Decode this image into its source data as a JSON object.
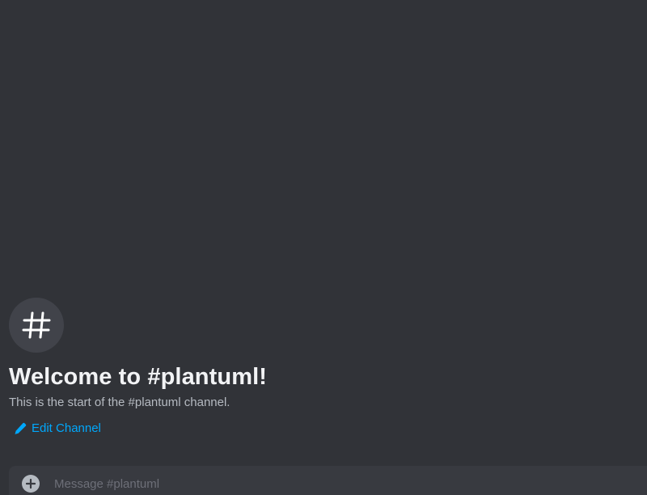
{
  "channel": {
    "name": "plantuml",
    "icon": "hash-icon"
  },
  "welcome": {
    "title": "Welcome to #plantuml!",
    "subtitle": "This is the start of the #plantuml channel.",
    "edit_label": "Edit Channel",
    "edit_icon": "pencil-icon"
  },
  "composer": {
    "placeholder": "Message #plantuml",
    "value": "",
    "attach_icon": "plus-circle-icon"
  },
  "colors": {
    "background": "#313338",
    "link": "#00a8fc",
    "title": "#f2f3f5",
    "muted": "#b5bac1",
    "composer_bg": "#383a40"
  }
}
